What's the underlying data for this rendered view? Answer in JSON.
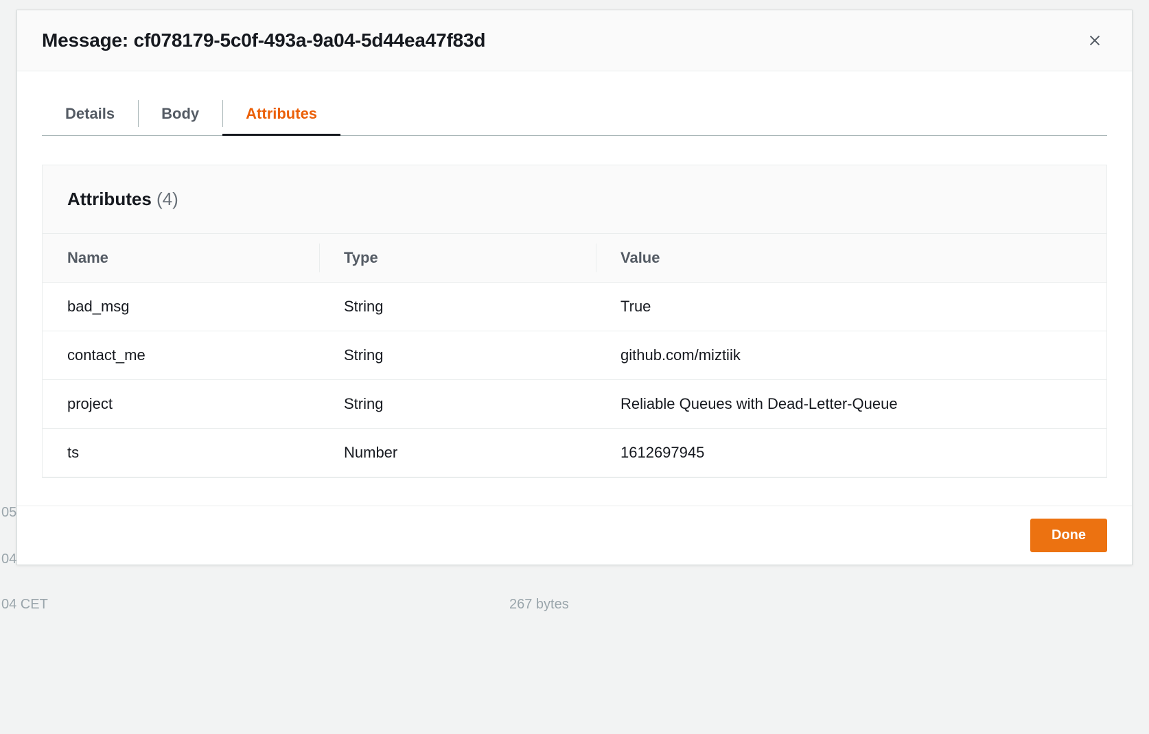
{
  "modal": {
    "title": "Message: cf078179-5c0f-493a-9a04-5d44ea47f83d",
    "tabs": [
      {
        "label": "Details",
        "active": false
      },
      {
        "label": "Body",
        "active": false
      },
      {
        "label": "Attributes",
        "active": true
      }
    ],
    "panel": {
      "title": "Attributes",
      "count": "(4)",
      "columns": [
        "Name",
        "Type",
        "Value"
      ],
      "rows": [
        {
          "name": "bad_msg",
          "type": "String",
          "value": "True"
        },
        {
          "name": "contact_me",
          "type": "String",
          "value": "github.com/miztiik"
        },
        {
          "name": "project",
          "type": "String",
          "value": "Reliable Queues with Dead-Letter-Queue"
        },
        {
          "name": "ts",
          "type": "Number",
          "value": "1612697945"
        }
      ]
    },
    "footer": {
      "done": "Done"
    }
  },
  "background_hints": {
    "left1": "05",
    "left2": "04",
    "bottom_left": "04 CET",
    "bottom_right": "267 bytes"
  }
}
